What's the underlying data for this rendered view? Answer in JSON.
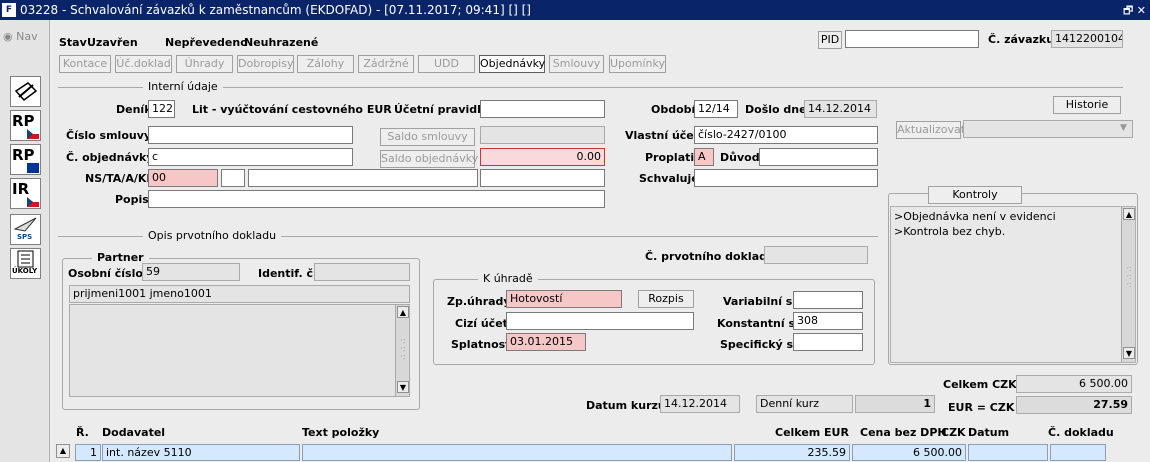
{
  "window": {
    "title": "03228 - Schvalování závazků k zaměstnancům (EKDOFAD) - [07.11.2017; 09:41] [] []",
    "logo_text": "F",
    "controls": "🗗 ✕"
  },
  "leftbar": {
    "nav_label": "Nav",
    "tools": [
      {
        "label": "",
        "icon": "edit-document-icon"
      },
      {
        "label": "RP",
        "icon": "rp-cz-icon"
      },
      {
        "label": "RP",
        "icon": "rp-eu-icon"
      },
      {
        "label": "IR",
        "icon": "ir-cz-icon"
      },
      {
        "label": "SPS",
        "icon": "sps-plane-icon"
      },
      {
        "label": "ÚKOLY",
        "icon": "tasks-icon"
      }
    ]
  },
  "header": {
    "stav_label": "Stav",
    "stav_value": "Uzavřen",
    "neprevedeno": "Nepřevedeno",
    "neuhrazene": "Neuhrazené",
    "pid_button": "PID",
    "pid_value": "",
    "cislo_zavazku_label": "Č. závazku",
    "cislo_zavazku_value": "1412200104"
  },
  "tabs": [
    "Kontace",
    "Úč.doklad",
    "Úhrady",
    "Dobropisy",
    "Zálohy",
    "Zádržné",
    "UDD",
    "Objednávky",
    "Smlouvy",
    "Upomínky"
  ],
  "active_tab": "Objednávky",
  "interni": {
    "section_title": "Interní údaje",
    "denik_label": "Deník",
    "denik_value": "122",
    "denik_desc": "Lit - vyúčtování cestovného EUR",
    "ucetni_pravidlo_label": "Účetní pravidlo",
    "ucetni_pravidlo_value": "",
    "obdobi_label": "Období",
    "obdobi_value": "12/14",
    "doslo_dne_label": "Došlo dne",
    "doslo_dne_value": "14.12.2014",
    "historie_button": "Historie",
    "cislo_smlouvy_label": "Číslo smlouvy",
    "cislo_smlouvy_value": "",
    "saldo_smlouvy_button": "Saldo smlouvy",
    "saldo_smlouvy_value": "",
    "vlastni_ucet_label": "Vlastní účet",
    "vlastni_ucet_value": "číslo-2427/0100",
    "aktualizovat_button": "Aktualizovat",
    "aktualizovat_select": "",
    "c_objednavky_label": "Č. objednávky",
    "c_objednavky_value": "c",
    "saldo_objednavky_button": "Saldo objednávky",
    "saldo_objednavky_value": "0.00",
    "proplatit_label": "Proplatit",
    "proplatit_value": "A",
    "duvod_label": "Důvod",
    "duvod_value": "",
    "nstaakp_label": "NS/TA/A/KP",
    "nstaakp_values": [
      "00",
      "",
      "",
      ""
    ],
    "schvaluje_label": "Schvaluje",
    "schvaluje_value": "",
    "popis_label": "Popis",
    "popis_value": ""
  },
  "kontroly": {
    "button": "Kontroly",
    "messages": [
      ">Objednávka není v evidenci",
      ">Kontrola bez chyb."
    ]
  },
  "opis": {
    "section_title": "Opis prvotního dokladu",
    "partner_title": "Partner",
    "osobni_cislo_label": "Osobní číslo",
    "osobni_cislo_value": "59",
    "identif_label": "Identif. č.",
    "identif_value": "",
    "name_value": "prijmeni1001 jmeno1001",
    "address_value": "",
    "c_prvotniho_label": "Č. prvotního dokladu",
    "c_prvotniho_value": ""
  },
  "k_uhrade": {
    "title": "K úhradě",
    "zp_uhrady_label": "Zp.úhrady",
    "zp_uhrady_value": "Hotovostí",
    "rozpis_button": "Rozpis",
    "cizi_ucet_label": "Cizí účet",
    "cizi_ucet_value": "",
    "splatnost_label": "Splatnost",
    "splatnost_value": "03.01.2015",
    "variabilni_label": "Variabilní s.",
    "variabilni_value": "",
    "konstantni_label": "Konstantní s.",
    "konstantni_value": "308",
    "specificky_label": "Specifický s.",
    "specificky_value": ""
  },
  "totals": {
    "celkem_czk_label": "Celkem CZK",
    "celkem_czk_value": "6 500.00",
    "datum_kurzu_label": "Datum kurzu",
    "datum_kurzu_value": "14.12.2014",
    "denni_kurz_value": "Denní kurz",
    "kurz_qty": "1",
    "eur_czk_label": "EUR = CZK",
    "eur_czk_value": "27.59"
  },
  "grid": {
    "headers": [
      "Ř.",
      "Dodavatel",
      "Text položky",
      "Celkem",
      "EUR",
      "Cena bez DPH",
      "CZK",
      "Datum",
      "Č. dokladu"
    ],
    "rows": [
      {
        "r": "1",
        "dodavatel": "int. název 5110",
        "text": "",
        "celkem": "235.59",
        "cena": "6 500.00",
        "datum": "",
        "doklad": ""
      }
    ]
  }
}
